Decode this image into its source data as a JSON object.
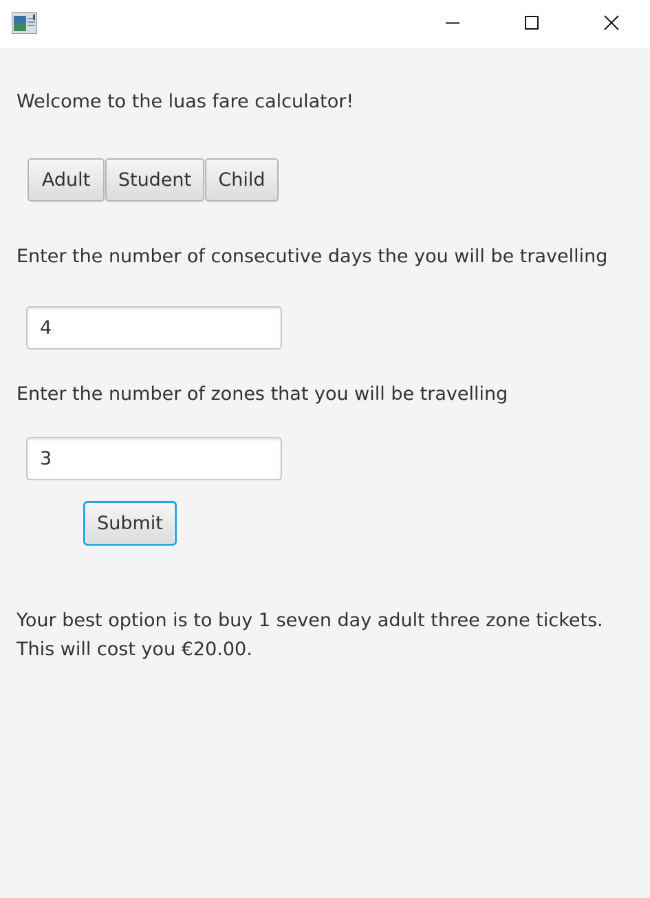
{
  "window": {
    "icon": "java-app-icon",
    "controls": {
      "minimize": "minimize-icon",
      "maximize": "maximize-icon",
      "close": "close-icon"
    }
  },
  "content": {
    "welcome": "Welcome to the luas fare calculator!",
    "fare_types": [
      {
        "label": "Adult"
      },
      {
        "label": "Student"
      },
      {
        "label": "Child"
      }
    ],
    "days_label": "Enter the number of consecutive days the you will be travelling",
    "days_value": "4",
    "zones_label": "Enter the number of zones that you will be travelling",
    "zones_value": "3",
    "submit_label": "Submit",
    "result_line_1": "Your best option is to buy 1 seven day adult three zone tickets.",
    "result_line_2": "This will cost you €20.00."
  },
  "colors": {
    "background": "#f4f4f4",
    "titlebar": "#ffffff",
    "text": "#333333",
    "focus_border": "#29a6e0"
  }
}
